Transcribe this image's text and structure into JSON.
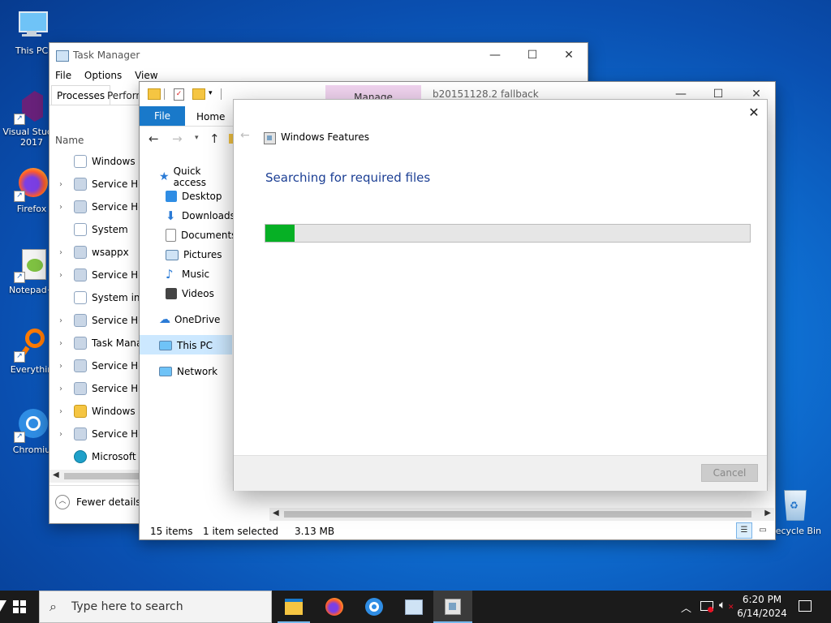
{
  "desktop": {
    "icons": [
      {
        "label": "This PC"
      },
      {
        "label": "Visual Studio"
      },
      {
        "label": "2017"
      },
      {
        "label": "Firefox"
      },
      {
        "label": "Notepad+"
      },
      {
        "label": "Everythin"
      },
      {
        "label": "Chromiu"
      },
      {
        "label": "Recycle Bin"
      }
    ]
  },
  "task_manager": {
    "title": "Task Manager",
    "menu": [
      "File",
      "Options",
      "View"
    ],
    "tabs": [
      "Processes",
      "Perform"
    ],
    "column_name": "Name",
    "rows": [
      "Windows M",
      "Service Hos",
      "Service Hos",
      "System",
      "wsappx",
      "Service Hos",
      "System inte",
      "Service Hos",
      "Task Manag",
      "Service Hos",
      "Service Hos",
      "Windows E",
      "Service Hos",
      "Microsoft E"
    ],
    "fewer_details": "Fewer details"
  },
  "explorer": {
    "tab_manage": "Manage",
    "title": "b20151128.2 fallback",
    "ribbon": {
      "file": "File",
      "home": "Home"
    },
    "nav": {
      "quick_access": "Quick access",
      "desktop": "Desktop",
      "downloads": "Downloads",
      "documents": "Documents",
      "pictures": "Pictures",
      "music": "Music",
      "videos": "Videos",
      "onedrive": "OneDrive",
      "this_pc": "This PC",
      "network": "Network"
    },
    "status": {
      "items": "15 items",
      "selected": "1 item selected",
      "size": "3.13 MB"
    }
  },
  "dialog": {
    "title": "Windows Features",
    "heading": "Searching for required files",
    "progress_fraction": 0.06,
    "cancel": "Cancel",
    "accent": "#06b025"
  },
  "taskbar": {
    "search_placeholder": "Type here to search",
    "time": "6:20 PM",
    "date": "6/14/2024"
  }
}
